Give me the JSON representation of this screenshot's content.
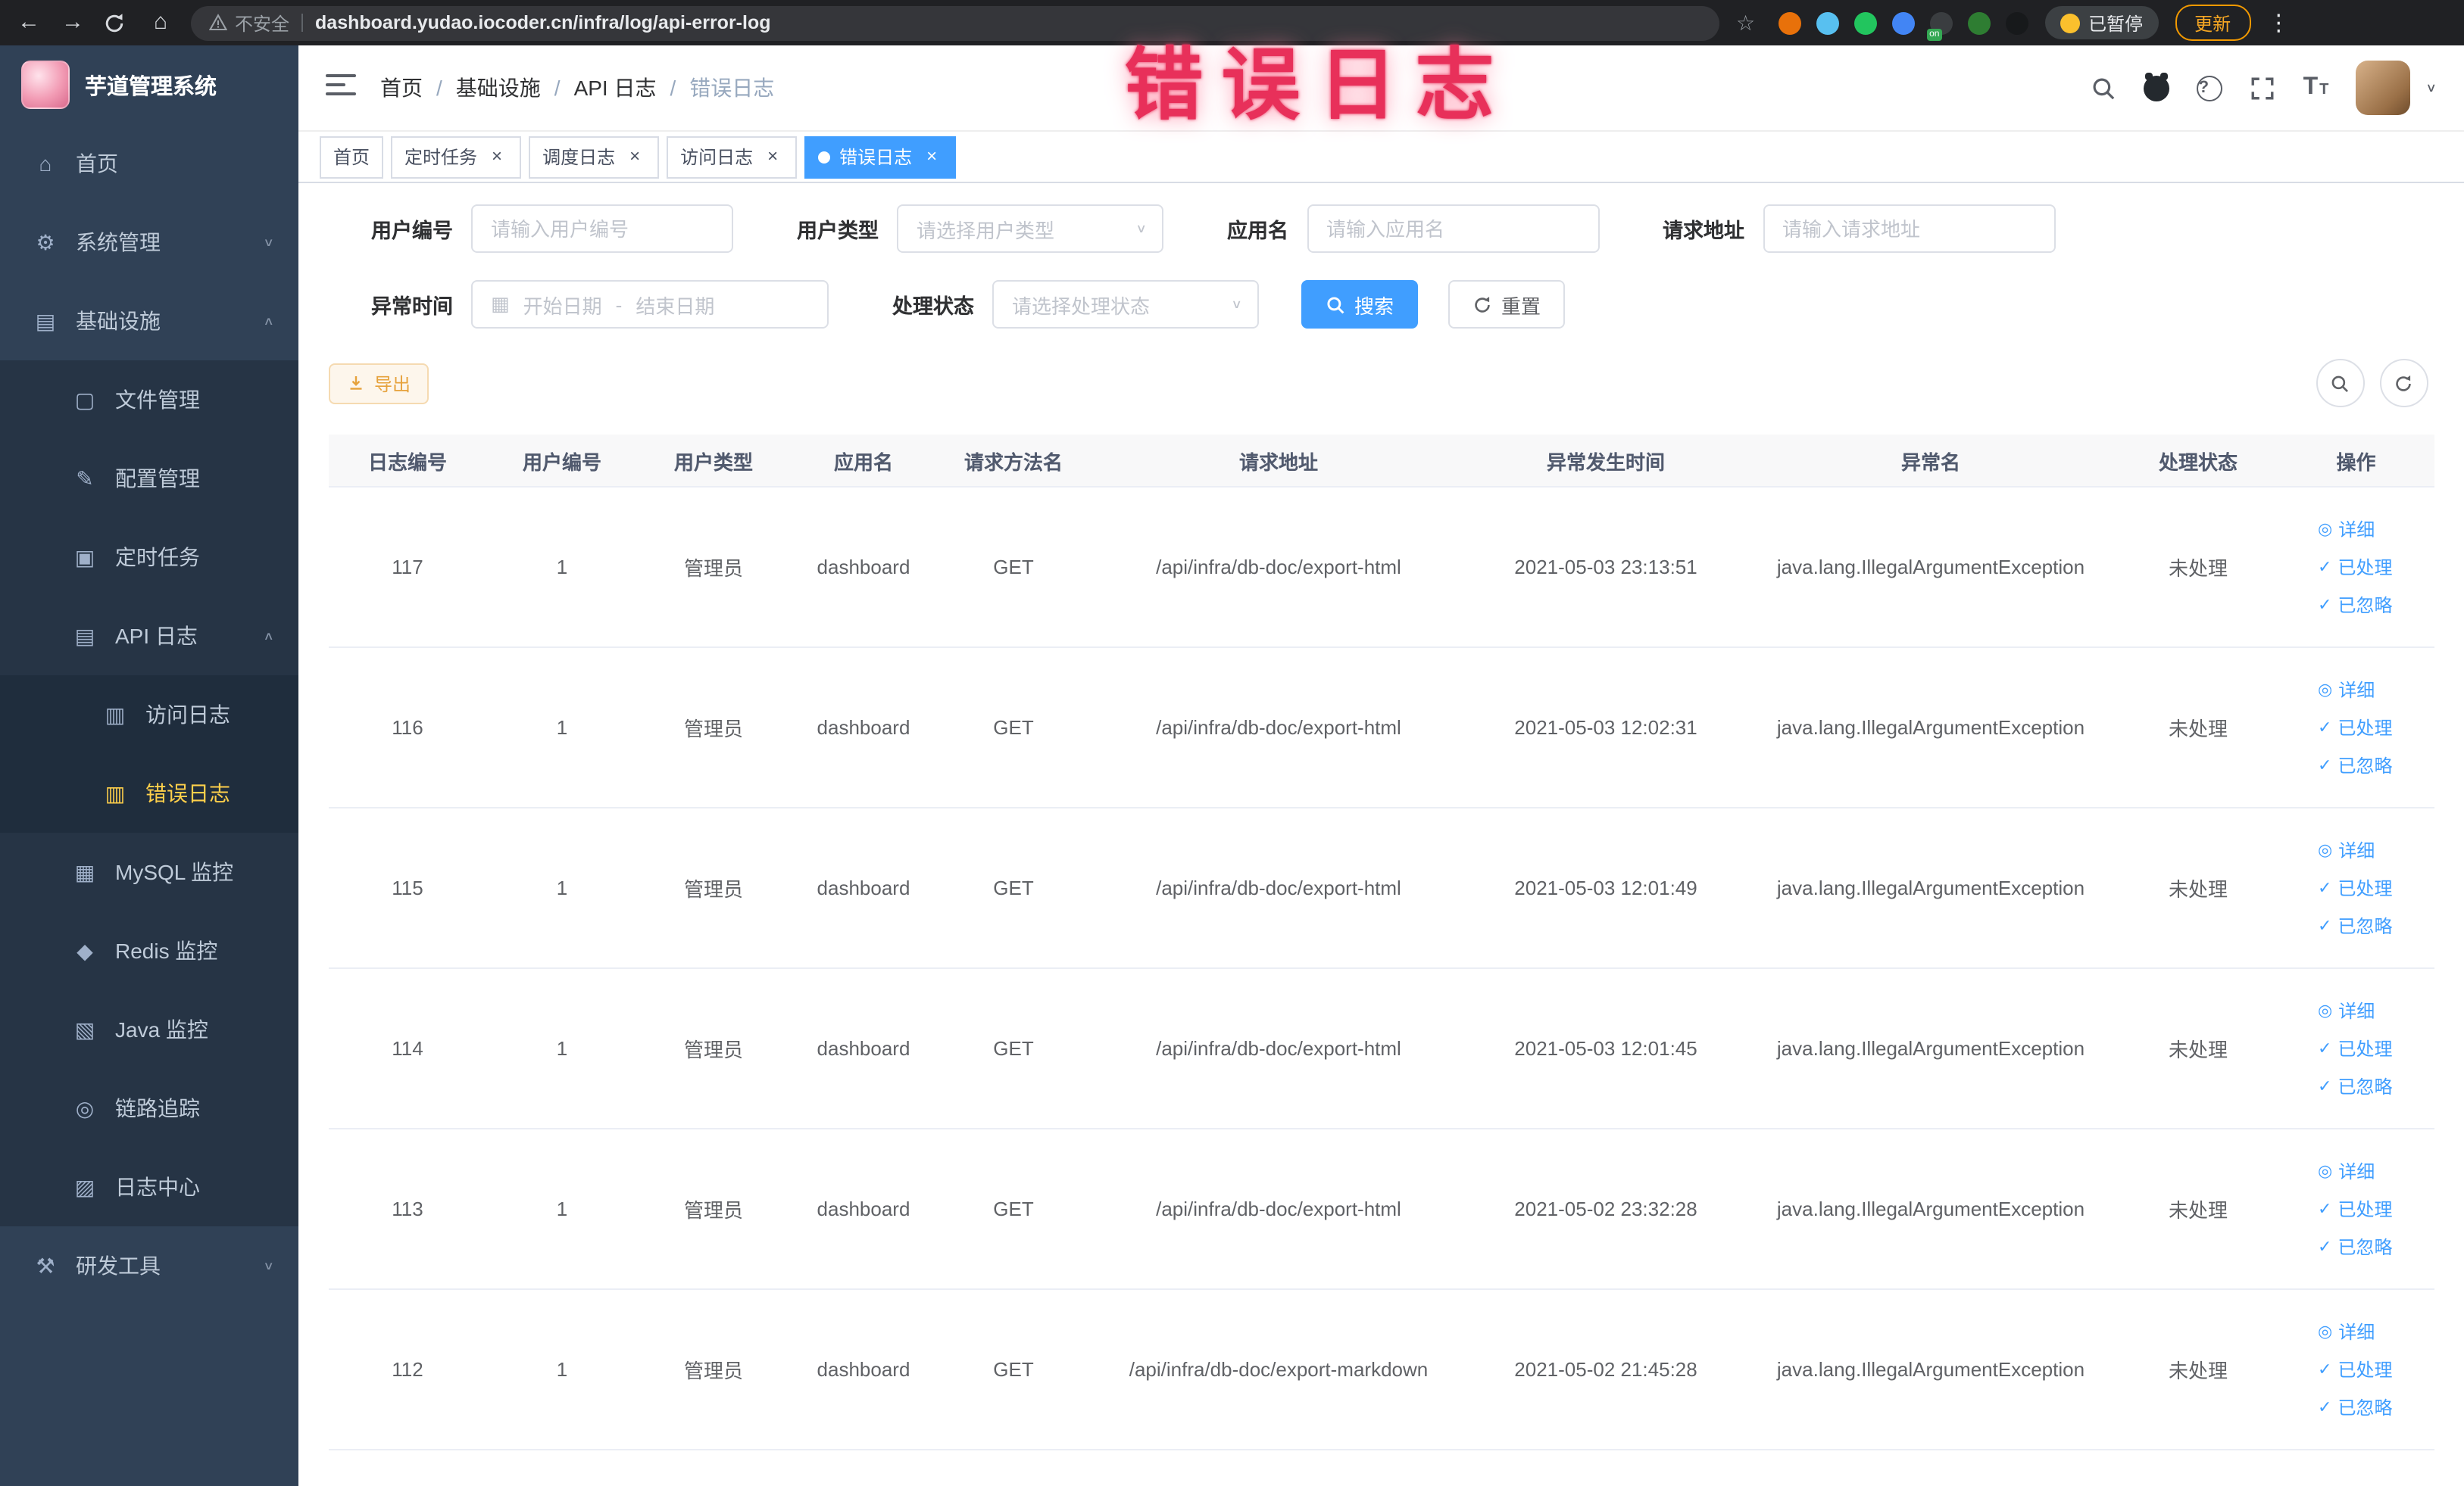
{
  "annotation": {
    "text": "错误日志"
  },
  "browser": {
    "security_label": "不安全",
    "url": "dashboard.yudao.iocoder.cn/infra/log/api-error-log",
    "paused_label": "已暂停",
    "update_label": "更新",
    "extensions": [
      {
        "color": "#e8710a"
      },
      {
        "color": "#58c0f0"
      },
      {
        "color": "#22c55e"
      },
      {
        "color": "#4285f4"
      },
      {
        "color": "#3a3d40",
        "badge": "on"
      },
      {
        "color": "#2e7d32"
      },
      {
        "color": "#17191b"
      }
    ]
  },
  "icons": {
    "back": "←",
    "forward": "→",
    "home": "⌂",
    "star": "☆",
    "more": "⋮",
    "close": "×",
    "chevron_down": "∨",
    "calendar": "▦",
    "detail": "◎",
    "check": "✓",
    "question": "?",
    "font_size_large": "T",
    "font_size_small": "T",
    "avatar_caret": "∨"
  },
  "sidebar": {
    "title": "芋道管理系统",
    "items": [
      {
        "label": "首页",
        "icon_glyph": "⌂",
        "level": 1,
        "chevron": ""
      },
      {
        "label": "系统管理",
        "icon_glyph": "⚙",
        "level": 1,
        "chevron": "∨"
      },
      {
        "label": "基础设施",
        "icon_glyph": "▤",
        "level": 1,
        "chevron": "∧"
      },
      {
        "label": "文件管理",
        "icon_glyph": "▢",
        "level": 2,
        "chevron": ""
      },
      {
        "label": "配置管理",
        "icon_glyph": "✎",
        "level": 2,
        "chevron": ""
      },
      {
        "label": "定时任务",
        "icon_glyph": "▣",
        "level": 2,
        "chevron": ""
      },
      {
        "label": "API 日志",
        "icon_glyph": "▤",
        "level": 2,
        "chevron": "∧"
      },
      {
        "label": "访问日志",
        "icon_glyph": "▥",
        "level": 3,
        "chevron": ""
      },
      {
        "label": "错误日志",
        "icon_glyph": "▥",
        "level": 3,
        "chevron": "",
        "active": true
      },
      {
        "label": "MySQL 监控",
        "icon_glyph": "▦",
        "level": 2,
        "chevron": ""
      },
      {
        "label": "Redis 监控",
        "icon_glyph": "◆",
        "level": 2,
        "chevron": ""
      },
      {
        "label": "Java 监控",
        "icon_glyph": "▧",
        "level": 2,
        "chevron": ""
      },
      {
        "label": "链路追踪",
        "icon_glyph": "◎",
        "level": 2,
        "chevron": ""
      },
      {
        "label": "日志中心",
        "icon_glyph": "▨",
        "level": 2,
        "chevron": ""
      },
      {
        "label": "研发工具",
        "icon_glyph": "⚒",
        "level": 1,
        "chevron": "∨"
      }
    ]
  },
  "header": {
    "breadcrumb": [
      "首页",
      "基础设施",
      "API 日志",
      "错误日志"
    ]
  },
  "tabs": [
    {
      "label": "首页",
      "closable": false,
      "active": false
    },
    {
      "label": "定时任务",
      "closable": true,
      "active": false
    },
    {
      "label": "调度日志",
      "closable": true,
      "active": false
    },
    {
      "label": "访问日志",
      "closable": true,
      "active": false
    },
    {
      "label": "错误日志",
      "closable": true,
      "active": true
    }
  ],
  "filters": {
    "user_id": {
      "label": "用户编号",
      "placeholder": "请输入用户编号"
    },
    "user_type": {
      "label": "用户类型",
      "placeholder": "请选择用户类型"
    },
    "app_name": {
      "label": "应用名",
      "placeholder": "请输入应用名"
    },
    "request_url": {
      "label": "请求地址",
      "placeholder": "请输入请求地址"
    },
    "exception_time": {
      "label": "异常时间",
      "start_placeholder": "开始日期",
      "end_placeholder": "结束日期",
      "separator": "-"
    },
    "process_status": {
      "label": "处理状态",
      "placeholder": "请选择处理状态"
    },
    "search_label": "搜索",
    "reset_label": "重置"
  },
  "toolbar": {
    "export_label": "导出"
  },
  "table": {
    "columns": [
      "日志编号",
      "用户编号",
      "用户类型",
      "应用名",
      "请求方法名",
      "请求地址",
      "异常发生时间",
      "异常名",
      "处理状态",
      "操作"
    ],
    "action_labels": [
      "详细",
      "已处理",
      "已忽略"
    ],
    "rows": [
      {
        "id": "117",
        "user_id": "1",
        "user_type": "管理员",
        "app": "dashboard",
        "method": "GET",
        "url": "/api/infra/db-doc/export-html",
        "time": "2021-05-03 23:13:51",
        "exception": "java.lang.IllegalArgumentException",
        "status": "未处理"
      },
      {
        "id": "116",
        "user_id": "1",
        "user_type": "管理员",
        "app": "dashboard",
        "method": "GET",
        "url": "/api/infra/db-doc/export-html",
        "time": "2021-05-03 12:02:31",
        "exception": "java.lang.IllegalArgumentException",
        "status": "未处理"
      },
      {
        "id": "115",
        "user_id": "1",
        "user_type": "管理员",
        "app": "dashboard",
        "method": "GET",
        "url": "/api/infra/db-doc/export-html",
        "time": "2021-05-03 12:01:49",
        "exception": "java.lang.IllegalArgumentException",
        "status": "未处理"
      },
      {
        "id": "114",
        "user_id": "1",
        "user_type": "管理员",
        "app": "dashboard",
        "method": "GET",
        "url": "/api/infra/db-doc/export-html",
        "time": "2021-05-03 12:01:45",
        "exception": "java.lang.IllegalArgumentException",
        "status": "未处理"
      },
      {
        "id": "113",
        "user_id": "1",
        "user_type": "管理员",
        "app": "dashboard",
        "method": "GET",
        "url": "/api/infra/db-doc/export-html",
        "time": "2021-05-02 23:32:28",
        "exception": "java.lang.IllegalArgumentException",
        "status": "未处理"
      },
      {
        "id": "112",
        "user_id": "1",
        "user_type": "管理员",
        "app": "dashboard",
        "method": "GET",
        "url": "/api/infra/db-doc/export-markdown",
        "time": "2021-05-02 21:45:28",
        "exception": "java.lang.IllegalArgumentException",
        "status": "未处理"
      }
    ]
  }
}
